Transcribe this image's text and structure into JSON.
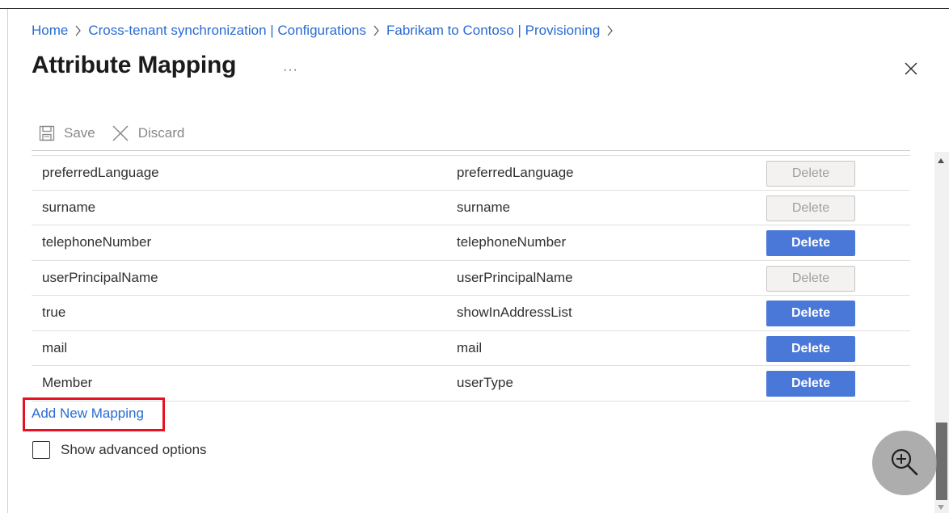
{
  "breadcrumb": {
    "items": [
      {
        "label": "Home"
      },
      {
        "label": "Cross-tenant synchronization | Configurations"
      },
      {
        "label": "Fabrikam to Contoso | Provisioning"
      }
    ]
  },
  "header": {
    "title": "Attribute Mapping",
    "more_label": "···"
  },
  "toolbar": {
    "save_label": "Save",
    "discard_label": "Discard"
  },
  "mappings": {
    "delete_label": "Delete",
    "rows": [
      {
        "source": "preferredLanguage",
        "target": "preferredLanguage",
        "delete_enabled": false
      },
      {
        "source": "surname",
        "target": "surname",
        "delete_enabled": false
      },
      {
        "source": "telephoneNumber",
        "target": "telephoneNumber",
        "delete_enabled": true
      },
      {
        "source": "userPrincipalName",
        "target": "userPrincipalName",
        "delete_enabled": false
      },
      {
        "source": "true",
        "target": "showInAddressList",
        "delete_enabled": true
      },
      {
        "source": "mail",
        "target": "mail",
        "delete_enabled": true
      },
      {
        "source": "Member",
        "target": "userType",
        "delete_enabled": true
      }
    ]
  },
  "add_mapping_label": "Add New Mapping",
  "advanced_options": {
    "label": "Show advanced options",
    "checked": false
  },
  "icons": {
    "save": "save-icon",
    "discard": "discard-icon",
    "close": "close-icon",
    "zoom": "zoom-in-icon",
    "breadcrumb_separator": "chevron-right-icon"
  },
  "colors": {
    "link": "#2a6bd1",
    "delete_enabled_bg": "#4a78d8",
    "delete_disabled_bg": "#f3f2f1",
    "highlight_border": "#e81123"
  }
}
